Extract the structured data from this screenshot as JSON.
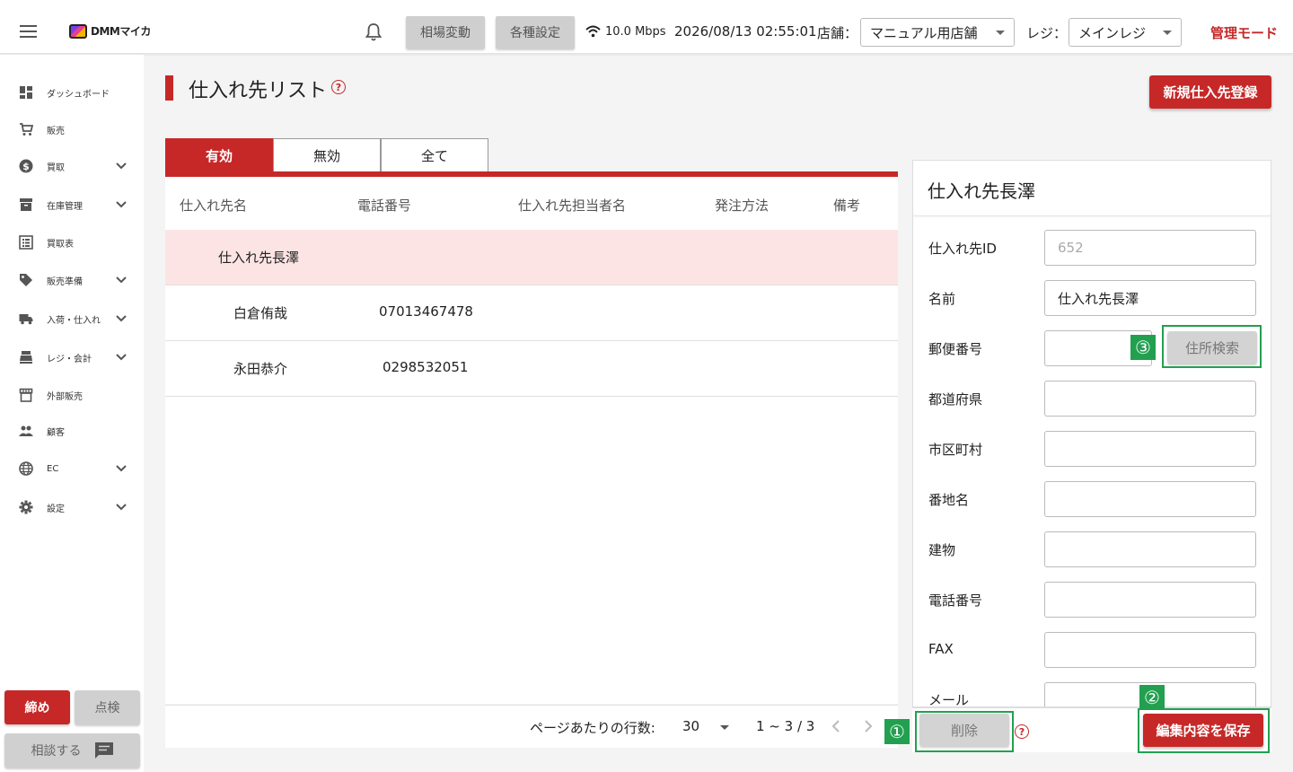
{
  "header": {
    "logo_text": "DMMマイカ",
    "market_btn": "相場変動",
    "settings_btn": "各種設定",
    "speed": "10.0 Mbps",
    "datetime": "2026/08/13 02:55:01",
    "store_label": "店舗：",
    "store_value": "マニュアル用店舗",
    "register_label": "レジ：",
    "register_value": "メインレジ",
    "admin_mode": "管理モード"
  },
  "sidebar": {
    "items": [
      {
        "label": "ダッシュボード",
        "icon": "dashboard-icon"
      },
      {
        "label": "販売",
        "icon": "cart-icon"
      },
      {
        "label": "買取",
        "icon": "dollar-icon"
      },
      {
        "label": "在庫管理",
        "icon": "archive-icon"
      },
      {
        "label": "買取表",
        "icon": "list-icon"
      },
      {
        "label": "販売準備",
        "icon": "tag-icon"
      },
      {
        "label": "入荷・仕入れ",
        "icon": "truck-icon"
      },
      {
        "label": "レジ・会計",
        "icon": "register-icon"
      },
      {
        "label": "外部販売",
        "icon": "store-icon"
      },
      {
        "label": "顧客",
        "icon": "people-icon"
      },
      {
        "label": "EC",
        "icon": "globe-icon"
      },
      {
        "label": "設定",
        "icon": "gear-icon"
      }
    ],
    "close_btn": "締め",
    "check_btn": "点検",
    "consult_btn": "相談する"
  },
  "main": {
    "title": "仕入れ先リスト",
    "new_btn": "新規仕入先登録",
    "tabs": [
      "有効",
      "無効",
      "全て"
    ],
    "columns": [
      "仕入れ先名",
      "電話番号",
      "仕入れ先担当者名",
      "発注方法",
      "備考"
    ],
    "rows": [
      {
        "name": "仕入れ先長澤",
        "phone": ""
      },
      {
        "name": "白倉侑哉",
        "phone": "07013467478"
      },
      {
        "name": "永田恭介",
        "phone": "0298532051"
      }
    ],
    "pager": {
      "rows_per_page_label": "ページあたりの行数:",
      "rows_per_page": "30",
      "range": "1 ~ 3 / 3"
    }
  },
  "detail": {
    "title": "仕入れ先長澤",
    "fields": [
      {
        "label": "仕入れ先ID",
        "value": "652"
      },
      {
        "label": "名前",
        "value": "仕入れ先長澤"
      },
      {
        "label": "郵便番号",
        "value": ""
      },
      {
        "label": "都道府県",
        "value": ""
      },
      {
        "label": "市区町村",
        "value": ""
      },
      {
        "label": "番地名",
        "value": ""
      },
      {
        "label": "建物",
        "value": ""
      },
      {
        "label": "電話番号",
        "value": ""
      },
      {
        "label": "FAX",
        "value": ""
      },
      {
        "label": "メール",
        "value": ""
      }
    ],
    "address_search_btn": "住所検索",
    "delete_btn": "削除",
    "save_btn": "編集内容を保存"
  },
  "annotations": [
    "①",
    "②",
    "③"
  ],
  "colors": {
    "accent": "#c62828",
    "annotation": "#22a050",
    "selected_row": "#fde4e4"
  }
}
